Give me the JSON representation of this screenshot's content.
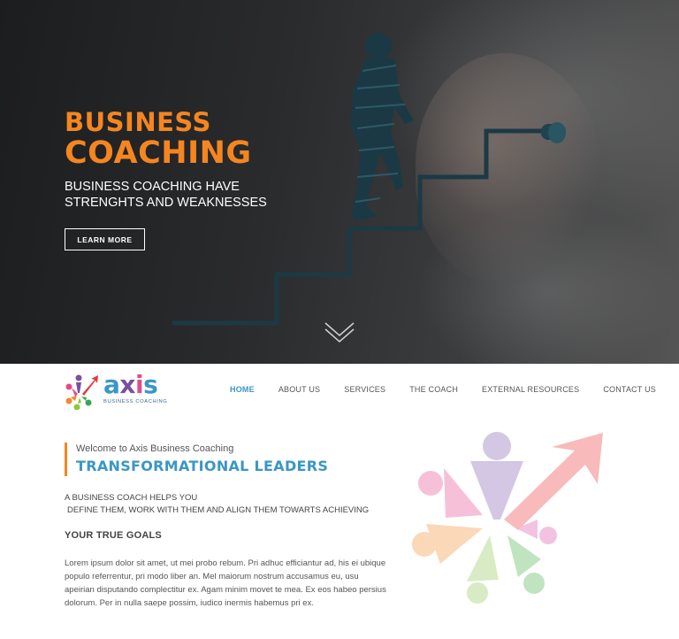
{
  "hero": {
    "title_line1": "BUSINESS",
    "title_line2": "COACHING",
    "subtitle": "BUSINESS COACHING HAVE STRENGHTS AND WEAKNESSES",
    "button_label": "LEARN MORE",
    "accent_color": "#f5861f"
  },
  "logo": {
    "word": "axis",
    "tagline": "BUSINESS COACHING"
  },
  "nav": {
    "items": [
      {
        "label": "HOME",
        "active": true
      },
      {
        "label": "ABOUT US"
      },
      {
        "label": "SERVICES"
      },
      {
        "label": "THE COACH"
      },
      {
        "label": "EXTERNAL RESOURCES"
      },
      {
        "label": "CONTACT US"
      }
    ],
    "active_color": "#3a97c4"
  },
  "content": {
    "welcome": "Welcome to Axis Business Coaching",
    "heading": "TRANSFORMATIONAL LEADERS",
    "intro_line1": "A BUSINESS COACH HELPS YOU",
    "intro_line2": "DEFINE THEM, WORK WITH THEM AND ALIGN THEM TOWARTS ACHIEVING",
    "goals_title": "YOUR TRUE GOALS",
    "lorem": "Lorem ipsum dolor sit amet, ut mei probo rebum. Pri adhuc efficiantur ad, his ei ubique populo referrentur, pri modo liber an. Mel maiorum nostrum accusamus eu, usu apeirian disputando complectitur ex. Agam minim movet te mea. Ex eos habeo persius dolorum. Per in nulla saepe possim, iudico inermis habemus pri ex."
  },
  "icons": [
    "chevron-down-icon",
    "axis-logo-icon",
    "stairs-climber-illustration",
    "people-arrow-watermark"
  ]
}
